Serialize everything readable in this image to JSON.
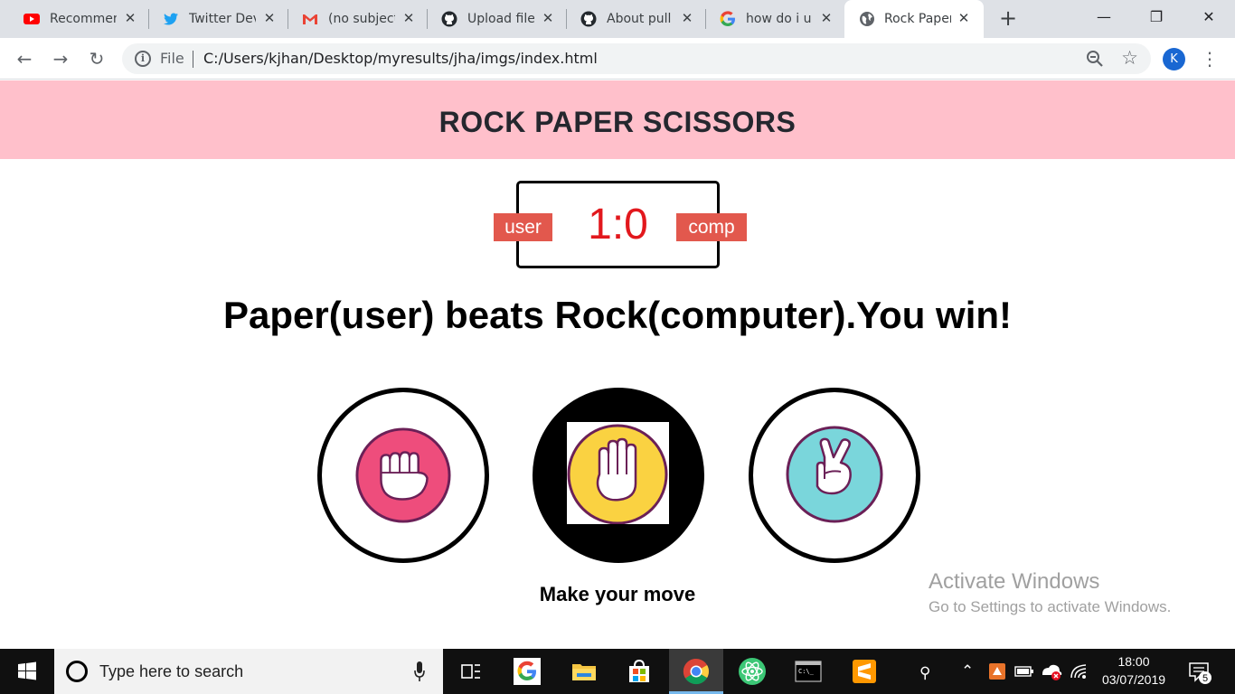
{
  "browser": {
    "tabs": [
      {
        "title": "Recommen",
        "icon": "youtube-icon",
        "active": false
      },
      {
        "title": "Twitter Dev",
        "icon": "twitter-icon",
        "active": false
      },
      {
        "title": "(no subject",
        "icon": "gmail-icon",
        "active": false
      },
      {
        "title": "Upload file",
        "icon": "github-icon",
        "active": false
      },
      {
        "title": "About pull",
        "icon": "github-icon",
        "active": false
      },
      {
        "title": "how do i u",
        "icon": "google-icon",
        "active": false
      },
      {
        "title": "Rock Paper",
        "icon": "globe-icon",
        "active": true
      }
    ],
    "address": {
      "scheme_label": "File",
      "url": "C:/Users/kjhan/Desktop/myresults/jha/imgs/index.html"
    },
    "profile_initial": "K"
  },
  "page": {
    "title": "ROCK PAPER SCISSORS",
    "scoreboard": {
      "user_label": "user",
      "comp_label": "comp",
      "score": "1:0"
    },
    "result": "Paper(user) beats Rock(computer).You win!",
    "choices": [
      {
        "name": "rock",
        "selected": false,
        "color": "#ee4d7c"
      },
      {
        "name": "paper",
        "selected": true,
        "color": "#fad241"
      },
      {
        "name": "scissors",
        "selected": false,
        "color": "#7ad6db"
      }
    ],
    "prompt": "Make your move"
  },
  "watermark": {
    "title": "Activate Windows",
    "subtitle": "Go to Settings to activate Windows."
  },
  "taskbar": {
    "search_placeholder": "Type here to search",
    "time": "18:00",
    "date": "03/07/2019",
    "notification_count": "5"
  }
}
